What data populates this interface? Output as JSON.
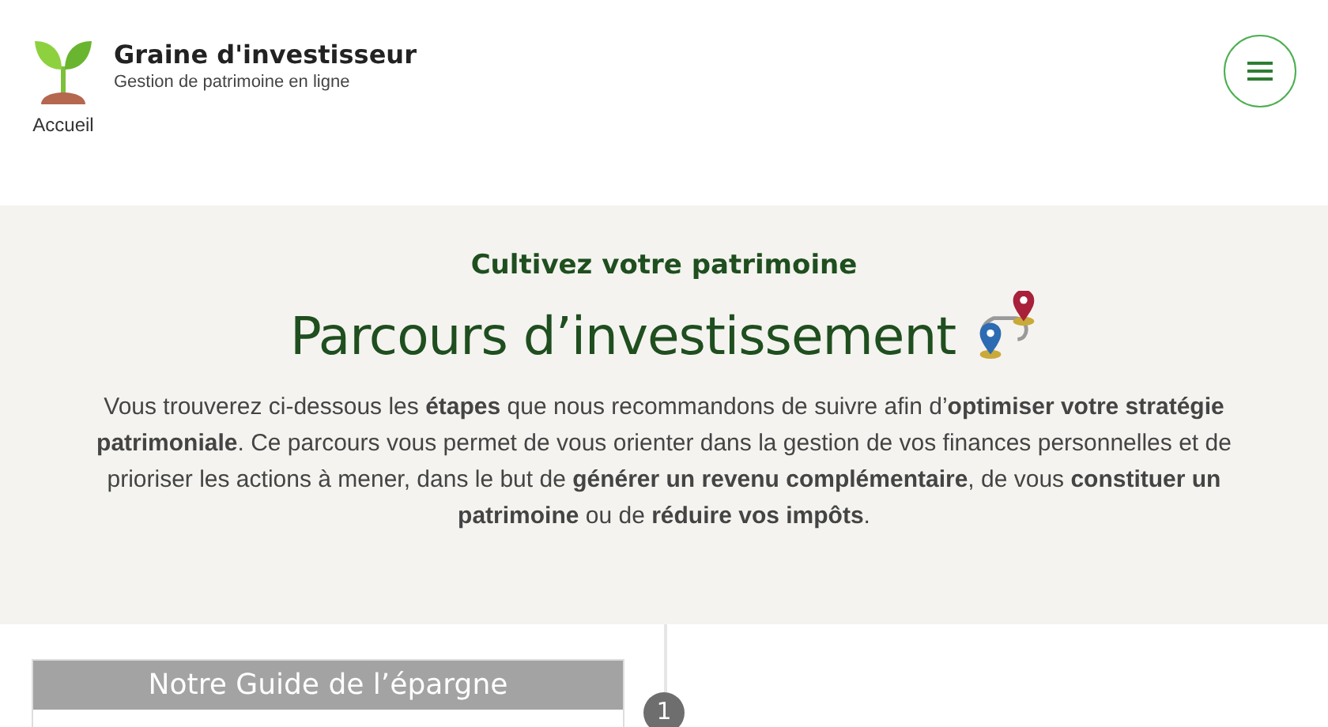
{
  "header": {
    "site_name": "Graine d'investisseur",
    "tagline": "Gestion de patrimoine en ligne",
    "home_link": "Accueil"
  },
  "hero": {
    "kicker": "Cultivez votre patrimoine",
    "title": "Parcours d’investissement",
    "intro": "Vous trouverez ci-dessous les **étapes** que nous recommandons de suivre afin d’**optimiser votre stratégie patrimoniale**. Ce parcours vous permet de vous orienter dans la gestion de vos finances personnelles et de prioriser les actions à mener, dans le but de **générer un revenu complémentaire**, de vous **constituer un patrimoine** ou de **réduire vos impôts**."
  },
  "steps": [
    {
      "title": "Notre Guide de l’épargne",
      "number": "1"
    }
  ]
}
